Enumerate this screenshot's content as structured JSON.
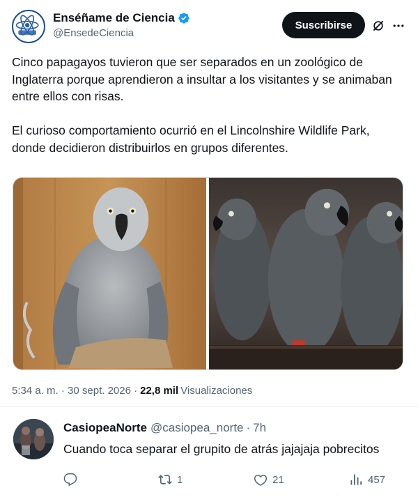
{
  "colors": {
    "text_primary": "#0f1419",
    "text_secondary": "#536471",
    "verified_blue": "#1d9bf0",
    "button_bg": "#0f1419",
    "button_text": "#ffffff",
    "divider": "#eff3f4"
  },
  "post": {
    "author": {
      "display_name": "Enséñame de Ciencia",
      "handle": "@EnsedeCiencia",
      "avatar_icon": "atom-logo",
      "verified_icon": "verified-badge-icon"
    },
    "subscribe_label": "Suscribirse",
    "grok_icon": "grok-icon",
    "more_icon": "more-dots-icon",
    "paragraphs": [
      "Cinco papagayos tuvieron que ser separados en un zoológico de Inglaterra porque aprendieron a insultar a los visitantes y se animaban entre ellos con risas.",
      "El curioso comportamiento ocurrió en el Lincolnshire Wildlife Park, donde decidieron distribuirlos en grupos diferentes."
    ],
    "media": [
      {
        "subject": "single grey parrot on perch"
      },
      {
        "subject": "three grey parrots on branch"
      }
    ],
    "timestamp": "5:34 a. m. · 30 sept. 2026 ·",
    "views_count": "22,8 mil",
    "views_label": "Visualizaciones"
  },
  "reply": {
    "display_name": "CasiopeaNorte",
    "handle": "@casiopea_norte",
    "separator": "·",
    "time": "7h",
    "text": "Cuando toca separar el grupito de atrás jajajaja pobrecitos",
    "actions": {
      "reply_icon": "reply-icon",
      "repost_icon": "repost-icon",
      "repost_count": "1",
      "like_icon": "heart-icon",
      "like_count": "21",
      "views_icon": "views-bar-icon",
      "views_count": "457"
    }
  }
}
